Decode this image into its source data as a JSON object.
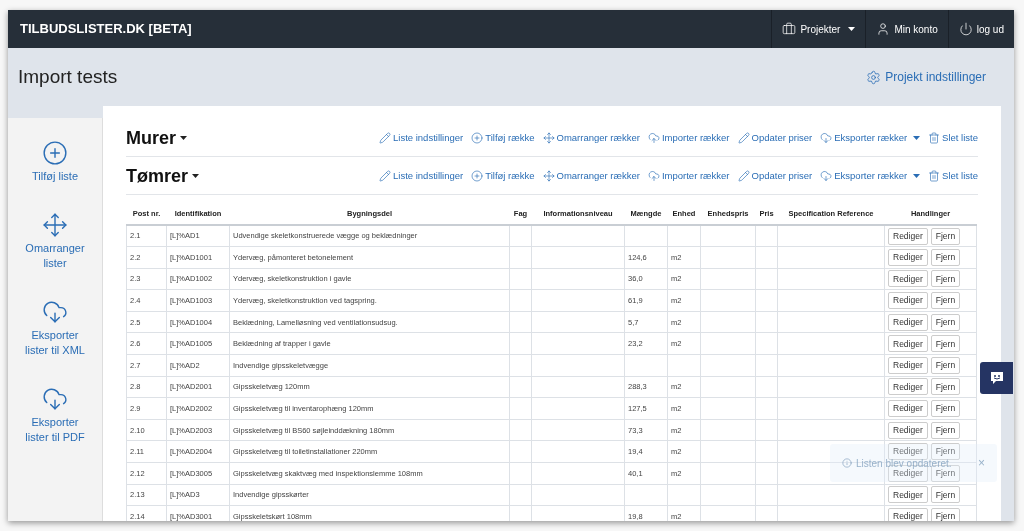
{
  "brand": "TILBUDSLISTER.DK [BETA]",
  "nav": [
    {
      "label": "Projekter",
      "kind": "projects",
      "dropdown": true
    },
    {
      "label": "Min konto",
      "kind": "account",
      "dropdown": false
    },
    {
      "label": "log ud",
      "kind": "logout",
      "dropdown": false
    }
  ],
  "page_title": "Import tests",
  "settings_link": "Projekt indstillinger",
  "sidebar": [
    {
      "label": "Tilføj liste",
      "kind": "add"
    },
    {
      "label": "Omarranger lister",
      "kind": "move"
    },
    {
      "label": "Eksporter lister til XML",
      "kind": "download"
    },
    {
      "label": "Eksporter lister til PDF",
      "kind": "download"
    }
  ],
  "lists": [
    {
      "title": "Murer",
      "actions": [
        {
          "label": "Liste indstillinger",
          "kind": "edit",
          "dropdown": false
        },
        {
          "label": "Tilføj række",
          "kind": "add",
          "dropdown": false
        },
        {
          "label": "Omarranger rækker",
          "kind": "move",
          "dropdown": false
        },
        {
          "label": "Importer rækker",
          "kind": "upload",
          "dropdown": false
        },
        {
          "label": "Opdater priser",
          "kind": "edit",
          "dropdown": false
        },
        {
          "label": "Eksporter rækker",
          "kind": "download",
          "dropdown": true
        },
        {
          "label": "Slet liste",
          "kind": "trash",
          "dropdown": false
        }
      ]
    },
    {
      "title": "Tømrer",
      "actions": [
        {
          "label": "Liste indstillinger",
          "kind": "edit",
          "dropdown": false
        },
        {
          "label": "Tilføj række",
          "kind": "add",
          "dropdown": false
        },
        {
          "label": "Omarranger rækker",
          "kind": "move",
          "dropdown": false
        },
        {
          "label": "Importer rækker",
          "kind": "upload",
          "dropdown": false
        },
        {
          "label": "Opdater priser",
          "kind": "edit",
          "dropdown": false
        },
        {
          "label": "Eksporter rækker",
          "kind": "download",
          "dropdown": true
        },
        {
          "label": "Slet liste",
          "kind": "trash",
          "dropdown": false
        }
      ],
      "table": {
        "columns": [
          "Post nr.",
          "Identifikation",
          "Bygningsdel",
          "Fag",
          "Informationsniveau",
          "Mængde",
          "Enhed",
          "Enhedspris",
          "Pris",
          "Specification Reference",
          "Handlinger"
        ],
        "rows": [
          {
            "post": "2.1",
            "id": "[L]%AD1",
            "description": "Udvendige skeletkonstruerede vægge og beklædninger",
            "quantity": "",
            "unit": "",
            "actions": [
              "Rediger",
              "Fjern"
            ]
          },
          {
            "post": "2.2",
            "id": "[L]%AD1001",
            "description": "Ydervæg, påmonteret betonelement",
            "quantity": "124,6",
            "unit": "m2",
            "actions": [
              "Rediger",
              "Fjern"
            ]
          },
          {
            "post": "2.3",
            "id": "[L]%AD1002",
            "description": "Ydervæg, skeletkonstruktion i gavle",
            "quantity": "36,0",
            "unit": "m2",
            "actions": [
              "Rediger",
              "Fjern"
            ]
          },
          {
            "post": "2.4",
            "id": "[L]%AD1003",
            "description": "Ydervæg, skeletkonstruktion ved tagspring.",
            "quantity": "61,9",
            "unit": "m2",
            "actions": [
              "Rediger",
              "Fjern"
            ]
          },
          {
            "post": "2.5",
            "id": "[L]%AD1004",
            "description": "Beklædning, Lamelløsning ved ventilationsudsug.",
            "quantity": "5,7",
            "unit": "m2",
            "actions": [
              "Rediger",
              "Fjern"
            ]
          },
          {
            "post": "2.6",
            "id": "[L]%AD1005",
            "description": "Beklædning af trapper i gavle",
            "quantity": "23,2",
            "unit": "m2",
            "actions": [
              "Rediger",
              "Fjern"
            ]
          },
          {
            "post": "2.7",
            "id": "[L]%AD2",
            "description": "Indvendige gipsskeletvægge",
            "quantity": "",
            "unit": "",
            "actions": [
              "Rediger",
              "Fjern"
            ]
          },
          {
            "post": "2.8",
            "id": "[L]%AD2001",
            "description": "Gipsskeletvæg 120mm",
            "quantity": "288,3",
            "unit": "m2",
            "actions": [
              "Rediger",
              "Fjern"
            ]
          },
          {
            "post": "2.9",
            "id": "[L]%AD2002",
            "description": "Gipsskeletvæg til inventarophæng 120mm",
            "quantity": "127,5",
            "unit": "m2",
            "actions": [
              "Rediger",
              "Fjern"
            ]
          },
          {
            "post": "2.10",
            "id": "[L]%AD2003",
            "description": "Gipsskeletvæg til BS60 søjleinddækning 180mm",
            "quantity": "73,3",
            "unit": "m2",
            "actions": [
              "Rediger",
              "Fjern"
            ]
          },
          {
            "post": "2.11",
            "id": "[L]%AD2004",
            "description": "Gipsskeletvæg til toiletinstallationer 220mm",
            "quantity": "19,4",
            "unit": "m2",
            "actions": [
              "Rediger",
              "Fjern"
            ]
          },
          {
            "post": "2.12",
            "id": "[L]%AD3005",
            "description": "Gipsskeletvæg skaktvæg med inspektionslemme 108mm",
            "quantity": "40,1",
            "unit": "m2",
            "actions": [
              "Rediger",
              "Fjern"
            ]
          },
          {
            "post": "2.13",
            "id": "[L]%AD3",
            "description": "Indvendige gipsskørter",
            "quantity": "",
            "unit": "",
            "actions": [
              "Rediger",
              "Fjern"
            ]
          },
          {
            "post": "2.14",
            "id": "[L]%AD3001",
            "description": "Gipsskeletskørt 108mm",
            "quantity": "19,8",
            "unit": "m2",
            "actions": [
              "Rediger",
              "Fjern"
            ]
          }
        ]
      }
    }
  ],
  "toast": {
    "message": "Listen blev opdateret.",
    "close": "×"
  }
}
